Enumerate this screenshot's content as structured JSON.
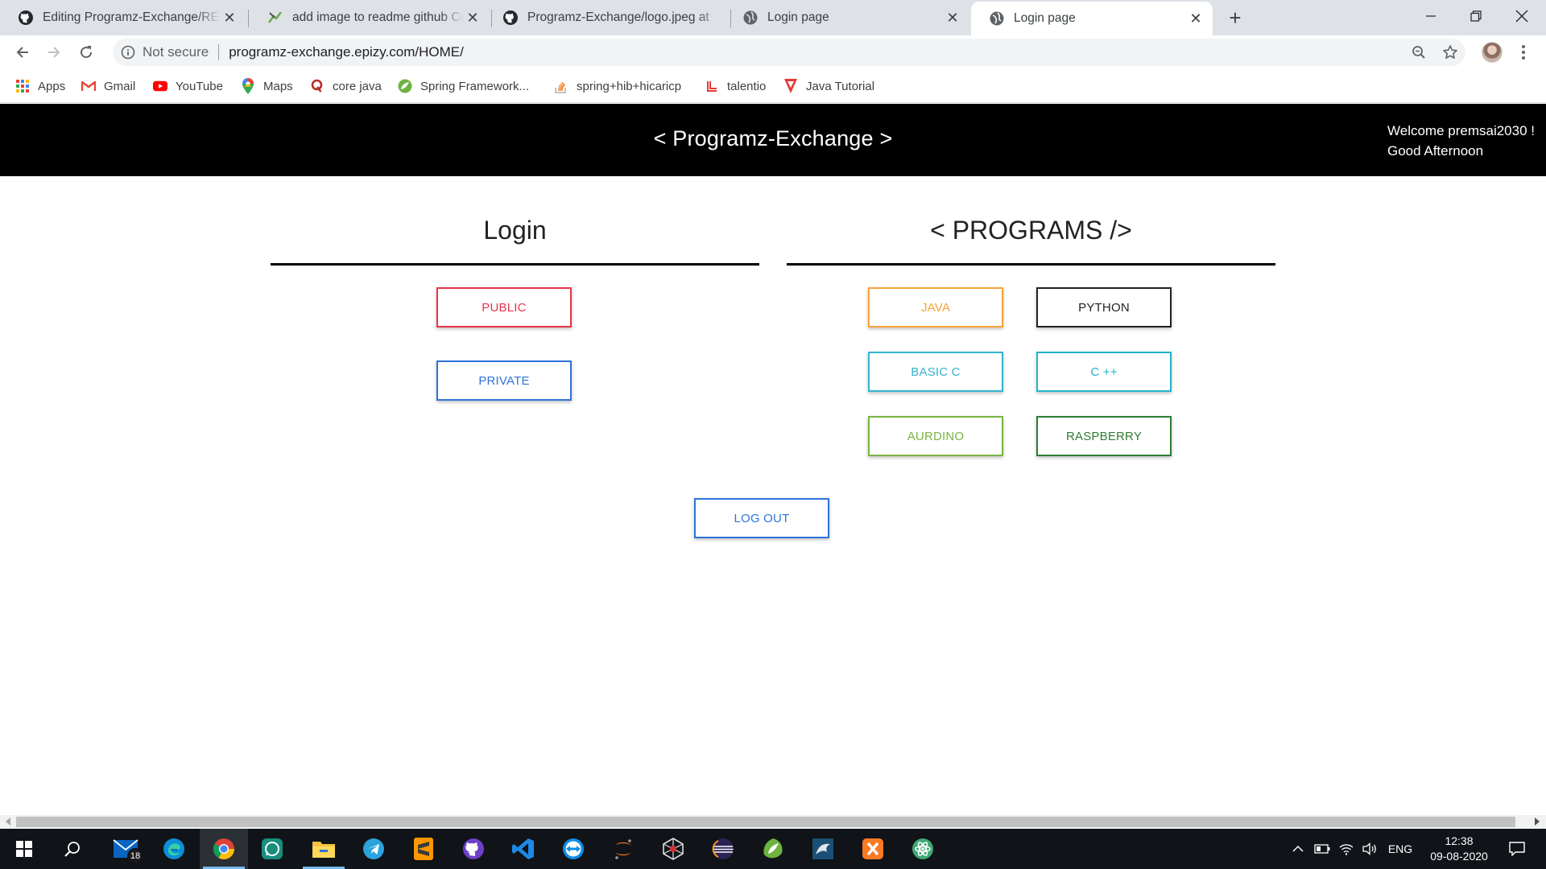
{
  "browser": {
    "tabs": [
      {
        "title": "Editing Programz-Exchange/README.md",
        "icon": "github-icon",
        "active": false
      },
      {
        "title": "add image to readme github Code",
        "icon": "grepper-icon",
        "active": false
      },
      {
        "title": "Programz-Exchange/logo.jpeg at",
        "icon": "github-icon",
        "active": false
      },
      {
        "title": "Login page",
        "icon": "globe-icon",
        "active": false
      },
      {
        "title": "Login page",
        "icon": "globe-icon",
        "active": true
      }
    ],
    "security_label": "Not secure",
    "url": "programz-exchange.epizy.com/HOME/",
    "bookmarks": [
      {
        "label": "Apps",
        "icon": "apps-grid-icon"
      },
      {
        "label": "Gmail",
        "icon": "gmail-icon"
      },
      {
        "label": "YouTube",
        "icon": "youtube-icon"
      },
      {
        "label": "Maps",
        "icon": "maps-icon"
      },
      {
        "label": "core java",
        "icon": "quora-icon"
      },
      {
        "label": "Spring Framework...",
        "icon": "spring-icon"
      },
      {
        "label": "spring+hib+hicaricp",
        "icon": "stackoverflow-icon"
      },
      {
        "label": "talentio",
        "icon": "talentio-icon"
      },
      {
        "label": "Java Tutorial",
        "icon": "tutorial-icon"
      }
    ]
  },
  "site": {
    "title": "< Programz-Exchange >",
    "welcome": "Welcome premsai2030 !",
    "greeting": "Good Afternoon"
  },
  "login": {
    "heading": "Login",
    "buttons": [
      {
        "label": "PUBLIC",
        "color": "#e8344a"
      },
      {
        "label": "PRIVATE",
        "color": "#2f73d9"
      }
    ]
  },
  "programs": {
    "heading": "< PROGRAMS />",
    "buttons": [
      {
        "label": "JAVA",
        "color": "#f6a43a"
      },
      {
        "label": "PYTHON",
        "color": "#222222"
      },
      {
        "label": "BASIC C",
        "color": "#35b4d0"
      },
      {
        "label": "C ++",
        "color": "#20b5cc"
      },
      {
        "label": "AURDINO",
        "color": "#7cb342"
      },
      {
        "label": "RASPBERRY",
        "color": "#2e7d32"
      }
    ]
  },
  "logout": {
    "label": "LOG OUT",
    "color": "#2f73d9"
  },
  "taskbar": {
    "mail_badge": "18",
    "apps": [
      "mail-icon",
      "edge-icon",
      "chrome-icon",
      "whatsapp-icon",
      "file-explorer-icon",
      "telegram-icon",
      "sublime-text-icon",
      "github-desktop-icon",
      "vscode-icon",
      "teamviewer-icon",
      "jupyter-icon",
      "spider-icon",
      "eclipse-icon",
      "spring-tools-icon",
      "mysql-workbench-icon",
      "xampp-icon",
      "atom-icon"
    ],
    "language": "ENG",
    "time": "12:38",
    "date": "09-08-2020"
  }
}
